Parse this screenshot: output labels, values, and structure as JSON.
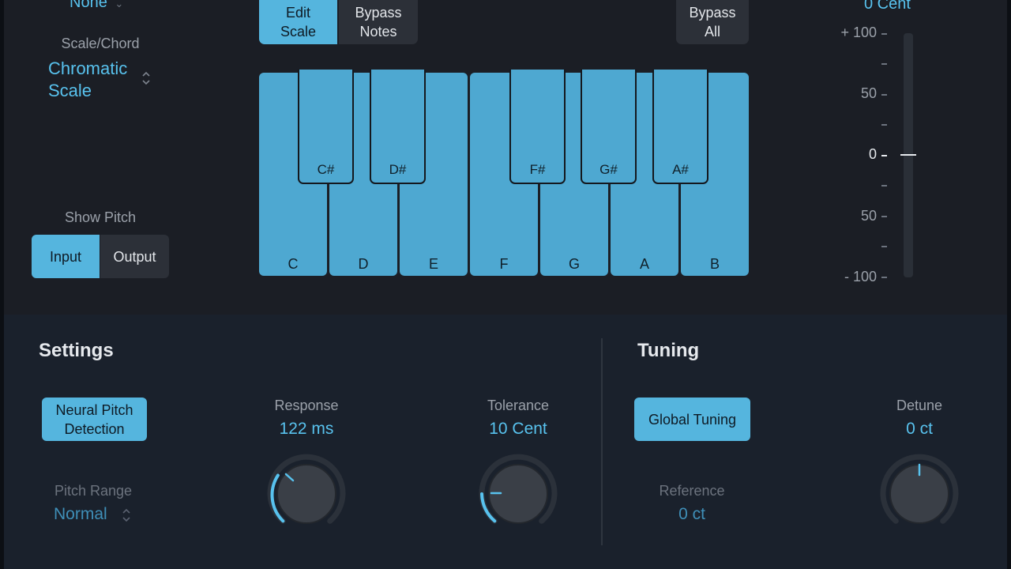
{
  "top": {
    "root_value": "None",
    "scale_label": "Scale/Chord",
    "scale_value_line1": "Chromatic",
    "scale_value_line2": "Scale",
    "show_pitch_label": "Show Pitch",
    "show_pitch_input": "Input",
    "show_pitch_output": "Output",
    "edit_scale_line1": "Edit",
    "edit_scale_line2": "Scale",
    "bypass_notes_line1": "Bypass",
    "bypass_notes_line2": "Notes",
    "bypass_all_line1": "Bypass",
    "bypass_all_line2": "All",
    "cent_readout": "0 Cent"
  },
  "keyboard": {
    "white_keys": [
      "C",
      "D",
      "E",
      "F",
      "G",
      "A",
      "B"
    ],
    "black_keys": [
      "C#",
      "D#",
      "F#",
      "G#",
      "A#"
    ]
  },
  "meter": {
    "labels": [
      "+ 100",
      "50",
      "0",
      "50",
      "- 100"
    ],
    "value": 0
  },
  "settings": {
    "title": "Settings",
    "neural_line1": "Neural Pitch",
    "neural_line2": "Detection",
    "pitch_range_label": "Pitch Range",
    "pitch_range_value": "Normal",
    "response_label": "Response",
    "response_value": "122 ms",
    "tolerance_label": "Tolerance",
    "tolerance_value": "10 Cent"
  },
  "tuning": {
    "title": "Tuning",
    "global_tuning": "Global Tuning",
    "reference_label": "Reference",
    "reference_value": "0 ct",
    "detune_label": "Detune",
    "detune_value": "0 ct"
  },
  "colors": {
    "accent": "#58c2ee",
    "key": "#4ea8d1",
    "button_on": "#55b5de"
  }
}
